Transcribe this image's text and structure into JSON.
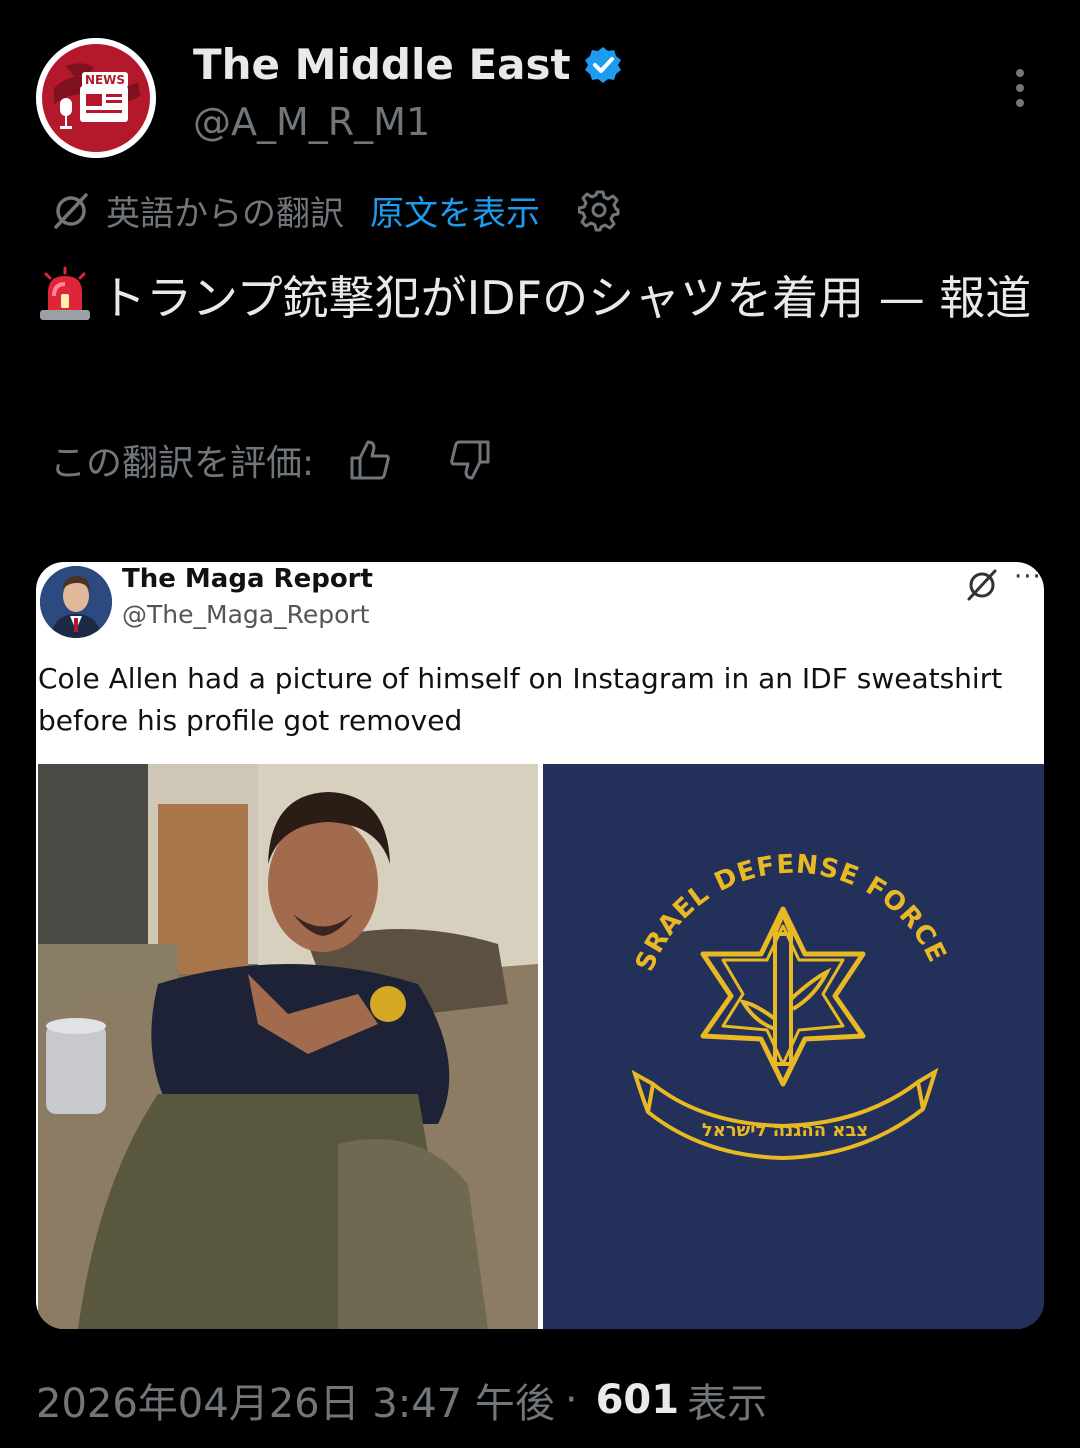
{
  "author": {
    "name": "The Middle East",
    "handle": "@A_M_R_M1",
    "avatar_badge": "NEWS",
    "verified": true
  },
  "translation": {
    "label": "英語からの翻訳",
    "show_original": "原文を表示"
  },
  "tweet": {
    "text": "トランプ銃撃犯がIDFのシャツを着用 — 報道",
    "leading_emoji": "police-light-emoji"
  },
  "rate": {
    "label": "この翻訳を評価:"
  },
  "quoted": {
    "name": "The Maga Report",
    "handle": "@The_Maga_Report",
    "more": "···",
    "text": "Cole Allen had a picture of himself on Instagram in an IDF sweatshirt before his profile got removed",
    "emblem_text": "ISRAEL DEFENSE FORCES",
    "emblem_hebrew": "צבא ההגנה לישראל"
  },
  "footer": {
    "datetime": "2026年04月26日 3:47 午後",
    "separator": "·",
    "views_count": "601",
    "views_label": "表示"
  },
  "colors": {
    "background": "#000000",
    "text": "#e7e9ea",
    "muted": "#71767b",
    "link": "#1d9bf0",
    "emblem_gold": "#e8b923",
    "shirt_navy": "#23305a"
  }
}
